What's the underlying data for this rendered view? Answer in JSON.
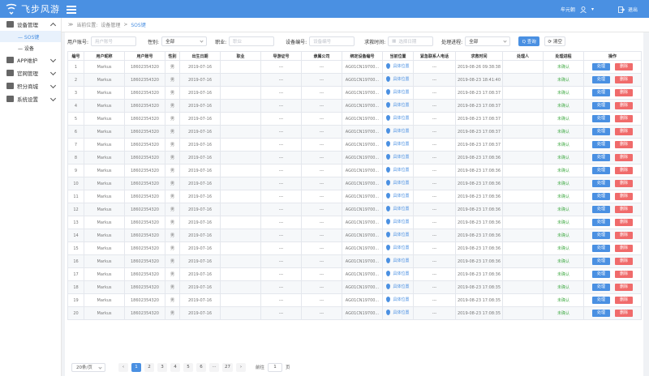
{
  "topbar": {
    "logo_text": "飞步风游",
    "user_name": "牟元朝",
    "logout_label": "退出"
  },
  "sidebar": {
    "items": [
      {
        "label": "设备管理",
        "icon": "device-icon",
        "expanded": true
      },
      {
        "label": "APP维护",
        "icon": "app-icon",
        "expanded": false
      },
      {
        "label": "官网管理",
        "icon": "website-icon",
        "expanded": false
      },
      {
        "label": "积分商城",
        "icon": "shop-icon",
        "expanded": false
      },
      {
        "label": "系统设置",
        "icon": "settings-icon",
        "expanded": false
      }
    ],
    "sub_items": [
      {
        "label": "— SOS键",
        "active": true
      },
      {
        "label": "— 设备",
        "active": false
      }
    ]
  },
  "breadcrumb": {
    "prefix": "当前位置:",
    "parent": "设备管理",
    "sep": ">",
    "current": "SOS键"
  },
  "filters": {
    "phone_label": "用户账号:",
    "phone_placeholder": "用户账号",
    "gender_label": "性别:",
    "gender_value": "全部",
    "job_label": "职业:",
    "job_placeholder": "职业",
    "device_label": "设备编号:",
    "device_placeholder": "设备编号",
    "time_label": "求救时间:",
    "time_placeholder": "选择日期",
    "status_label": "处理进程:",
    "status_value": "全部",
    "search_label": "Q 查询",
    "clear_label": "⟳ 清空"
  },
  "table": {
    "headers": [
      "编号",
      "用户昵称",
      "用户账号",
      "性别",
      "出生日期",
      "职业",
      "导游证号",
      "隶属公司",
      "绑定设备编号",
      "当前位置",
      "紧急联系人电话",
      "求救时间",
      "处理人",
      "处理进程",
      "操作"
    ],
    "location_label": "具体位置",
    "process_label": "处理",
    "delete_label": "删除",
    "rows": [
      {
        "id": "1",
        "nick": "Markus",
        "phone": "18602354320",
        "gender": "男",
        "birth": "2019-07-16",
        "job": "",
        "guide": "---",
        "company": "---",
        "device": "AG01CN19700...",
        "contact": "---",
        "time": "2019-08-26 09:38:38",
        "handler": "",
        "status": "未确认"
      },
      {
        "id": "2",
        "nick": "Markus",
        "phone": "18602354320",
        "gender": "男",
        "birth": "2019-07-16",
        "job": "",
        "guide": "---",
        "company": "---",
        "device": "AG01CN19700...",
        "contact": "---",
        "time": "2019-08-23 18:41:40",
        "handler": "",
        "status": "未确认"
      },
      {
        "id": "3",
        "nick": "Markus",
        "phone": "18602354320",
        "gender": "男",
        "birth": "2019-07-16",
        "job": "",
        "guide": "---",
        "company": "---",
        "device": "AG01CN19700...",
        "contact": "---",
        "time": "2019-08-23 17:08:37",
        "handler": "",
        "status": "未确认"
      },
      {
        "id": "4",
        "nick": "Markus",
        "phone": "18602354320",
        "gender": "男",
        "birth": "2019-07-16",
        "job": "",
        "guide": "---",
        "company": "---",
        "device": "AG01CN19700...",
        "contact": "---",
        "time": "2019-08-23 17:08:37",
        "handler": "",
        "status": "未确认"
      },
      {
        "id": "5",
        "nick": "Markus",
        "phone": "18602354320",
        "gender": "男",
        "birth": "2019-07-16",
        "job": "",
        "guide": "---",
        "company": "---",
        "device": "AG01CN19700...",
        "contact": "---",
        "time": "2019-08-23 17:08:37",
        "handler": "",
        "status": "未确认"
      },
      {
        "id": "6",
        "nick": "Markus",
        "phone": "18602354320",
        "gender": "男",
        "birth": "2019-07-16",
        "job": "",
        "guide": "---",
        "company": "---",
        "device": "AG01CN19700...",
        "contact": "---",
        "time": "2019-08-23 17:08:37",
        "handler": "",
        "status": "未确认"
      },
      {
        "id": "7",
        "nick": "Markus",
        "phone": "18602354320",
        "gender": "男",
        "birth": "2019-07-16",
        "job": "",
        "guide": "---",
        "company": "---",
        "device": "AG01CN19700...",
        "contact": "---",
        "time": "2019-08-23 17:08:37",
        "handler": "",
        "status": "未确认"
      },
      {
        "id": "8",
        "nick": "Markus",
        "phone": "18602354320",
        "gender": "男",
        "birth": "2019-07-16",
        "job": "",
        "guide": "---",
        "company": "---",
        "device": "AG01CN19700...",
        "contact": "---",
        "time": "2019-08-23 17:08:36",
        "handler": "",
        "status": "未确认"
      },
      {
        "id": "9",
        "nick": "Markus",
        "phone": "18602354320",
        "gender": "男",
        "birth": "2019-07-16",
        "job": "",
        "guide": "---",
        "company": "---",
        "device": "AG01CN19700...",
        "contact": "---",
        "time": "2019-08-23 17:08:36",
        "handler": "",
        "status": "未确认"
      },
      {
        "id": "10",
        "nick": "Markus",
        "phone": "18602354320",
        "gender": "男",
        "birth": "2019-07-16",
        "job": "",
        "guide": "---",
        "company": "---",
        "device": "AG01CN19700...",
        "contact": "---",
        "time": "2019-08-23 17:08:36",
        "handler": "",
        "status": "未确认"
      },
      {
        "id": "11",
        "nick": "Markus",
        "phone": "18602354320",
        "gender": "男",
        "birth": "2019-07-16",
        "job": "",
        "guide": "---",
        "company": "---",
        "device": "AG01CN19700...",
        "contact": "---",
        "time": "2019-08-23 17:08:36",
        "handler": "",
        "status": "未确认"
      },
      {
        "id": "12",
        "nick": "Markus",
        "phone": "18602354320",
        "gender": "男",
        "birth": "2019-07-16",
        "job": "",
        "guide": "---",
        "company": "---",
        "device": "AG01CN19700...",
        "contact": "---",
        "time": "2019-08-23 17:08:36",
        "handler": "",
        "status": "未确认"
      },
      {
        "id": "13",
        "nick": "Markus",
        "phone": "18602354320",
        "gender": "男",
        "birth": "2019-07-16",
        "job": "",
        "guide": "---",
        "company": "---",
        "device": "AG01CN19700...",
        "contact": "---",
        "time": "2019-08-23 17:08:36",
        "handler": "",
        "status": "未确认"
      },
      {
        "id": "14",
        "nick": "Markus",
        "phone": "18602354320",
        "gender": "男",
        "birth": "2019-07-16",
        "job": "",
        "guide": "---",
        "company": "---",
        "device": "AG01CN19700...",
        "contact": "---",
        "time": "2019-08-23 17:08:36",
        "handler": "",
        "status": "未确认"
      },
      {
        "id": "15",
        "nick": "Markus",
        "phone": "18602354320",
        "gender": "男",
        "birth": "2019-07-16",
        "job": "",
        "guide": "---",
        "company": "---",
        "device": "AG01CN19700...",
        "contact": "---",
        "time": "2019-08-23 17:08:36",
        "handler": "",
        "status": "未确认"
      },
      {
        "id": "16",
        "nick": "Markus",
        "phone": "18602354320",
        "gender": "男",
        "birth": "2019-07-16",
        "job": "",
        "guide": "---",
        "company": "---",
        "device": "AG01CN19700...",
        "contact": "---",
        "time": "2019-08-23 17:08:36",
        "handler": "",
        "status": "未确认"
      },
      {
        "id": "17",
        "nick": "Markus",
        "phone": "18602354320",
        "gender": "男",
        "birth": "2019-07-16",
        "job": "",
        "guide": "---",
        "company": "---",
        "device": "AG01CN19700...",
        "contact": "---",
        "time": "2019-08-23 17:08:36",
        "handler": "",
        "status": "未确认"
      },
      {
        "id": "18",
        "nick": "Markus",
        "phone": "18602354320",
        "gender": "男",
        "birth": "2019-07-16",
        "job": "",
        "guide": "---",
        "company": "---",
        "device": "AG01CN19700...",
        "contact": "---",
        "time": "2019-08-23 17:08:35",
        "handler": "",
        "status": "未确认"
      },
      {
        "id": "19",
        "nick": "Markus",
        "phone": "18602354320",
        "gender": "男",
        "birth": "2019-07-16",
        "job": "",
        "guide": "---",
        "company": "---",
        "device": "AG01CN19700...",
        "contact": "---",
        "time": "2019-08-23 17:08:35",
        "handler": "",
        "status": "未确认"
      },
      {
        "id": "20",
        "nick": "Markus",
        "phone": "18602354320",
        "gender": "男",
        "birth": "2019-07-16",
        "job": "",
        "guide": "---",
        "company": "---",
        "device": "AG01CN19700...",
        "contact": "---",
        "time": "2019-08-23 17:08:35",
        "handler": "",
        "status": "未确认"
      }
    ]
  },
  "pagination": {
    "page_size": "20条/页",
    "prev": "‹",
    "next": "›",
    "pages": [
      "1",
      "2",
      "3",
      "4",
      "5",
      "6",
      "···",
      "27"
    ],
    "current_page": "1",
    "goto_label": "前往",
    "goto_value": "1",
    "page_suffix": "页"
  },
  "colors": {
    "brand": "#4a90e2",
    "danger": "#f06b6b",
    "success": "#4caf50"
  }
}
